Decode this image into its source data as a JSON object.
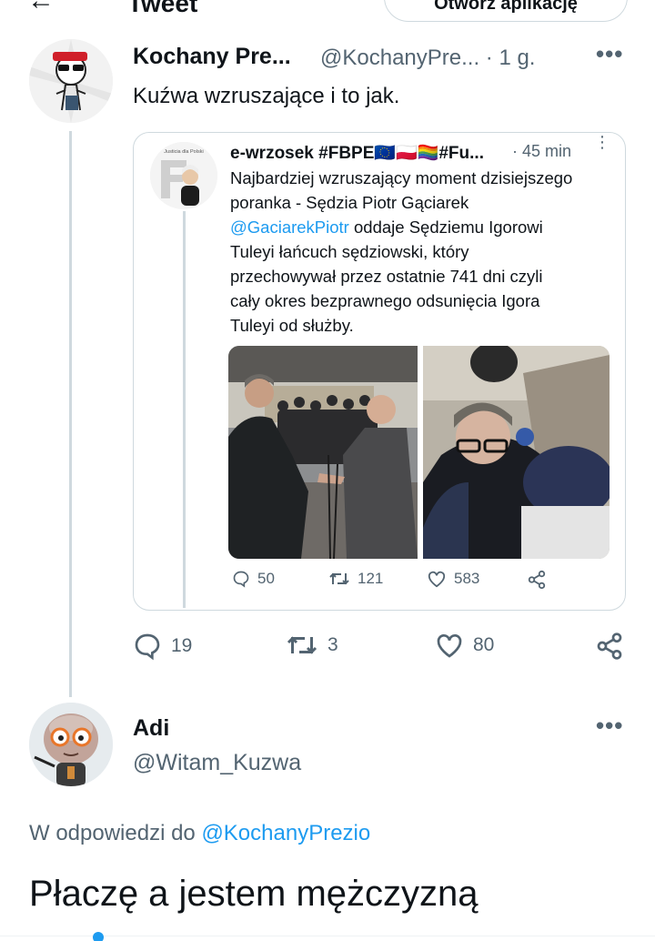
{
  "header": {
    "back_glyph": "←",
    "title": "Tweet",
    "open_app_label": "Otwórz aplikację"
  },
  "tweet": {
    "author_name": "Kochany Pre...",
    "author_handle": "@KochanyPre... · 1 g.",
    "menu": "•••",
    "text": "Kuźwa wzruszające i to jak.",
    "quote": {
      "author_name": "e-wrzosek #FBPE🇪🇺🇵🇱🏳️‍🌈#Fu...",
      "time": "· 45 min",
      "menu": "⋮",
      "lines": [
        "Najbardziej wzruszający moment dzisiejszego",
        "poranka - Sędzia Piotr Gąciarek"
      ],
      "mention": "@GaciarekPiotr",
      "after_mention": " oddaje Sędziemu Igorowi",
      "lines2": [
        "Tuleyi łańcuch sędziowski, który",
        "przechowywał przez ostatnie 741 dni czyli",
        "cały okres bezprawnego odsunięcia Igora",
        "Tuleyi od służby."
      ],
      "avatar_caption": "Justicia dla Polski",
      "stats": {
        "replies": "50",
        "retweets": "121",
        "likes": "583"
      }
    },
    "stats": {
      "replies": "19",
      "retweets": "3",
      "likes": "80"
    }
  },
  "reply": {
    "author_name": "Adi",
    "author_handle": "@Witam_Kuzwa",
    "menu": "•••",
    "reply_to_prefix": "W odpowiedzi do ",
    "reply_to_handle": "@KochanyPrezio",
    "text": "Płaczę a jestem mężczyzną"
  },
  "colors": {
    "accent": "#1d9bf0",
    "secondary_text": "#536471",
    "border": "#cfd9de"
  }
}
